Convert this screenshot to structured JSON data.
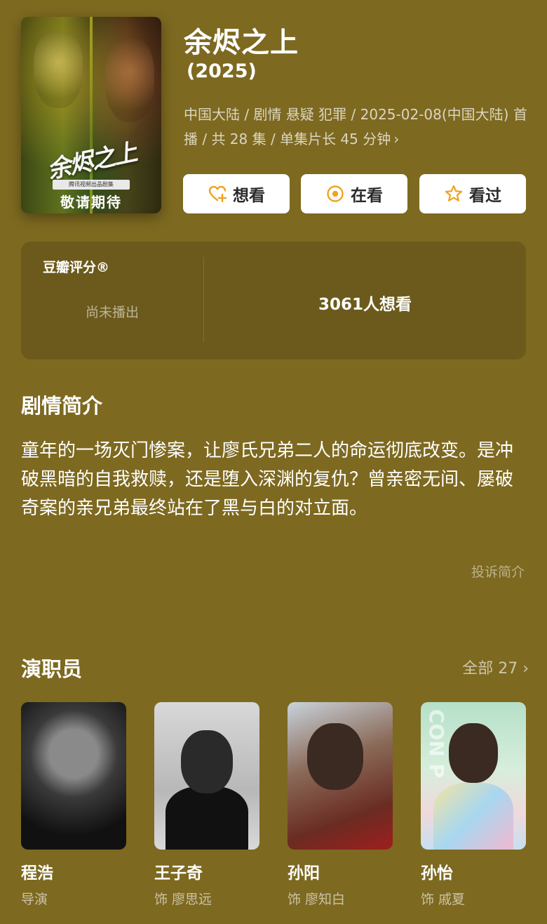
{
  "header": {
    "poster": {
      "logo_text": "余烬之上",
      "badge_text": "腾讯视频出品剧集",
      "coming_text": "敬请期待"
    },
    "title": "余烬之上",
    "year": "(2025)",
    "meta_line": "中国大陆 / 剧情 悬疑 犯罪 / 2025-02-08(中国大陆) 首播 / 共 28 集 / 单集片长 45 分钟",
    "meta_chevron": "›"
  },
  "actions": {
    "want_label": "想看",
    "watching_label": "在看",
    "watched_label": "看过"
  },
  "rating": {
    "label": "豆瓣评分®",
    "status": "尚未播出",
    "want_count_text": "3061人想看"
  },
  "synopsis": {
    "title": "剧情简介",
    "text": "童年的一场灭门惨案，让廖氏兄弟二人的命运彻底改变。是冲破黑暗的自我救赎，还是堕入深渊的复仇？曾亲密无间、屡破奇案的亲兄弟最终站在了黑与白的对立面。",
    "report_link": "投诉简介"
  },
  "cast": {
    "title": "演职员",
    "all_link": "全部 27 ›",
    "members": [
      {
        "name": "程浩",
        "role": "导演"
      },
      {
        "name": "王子奇",
        "role": "饰 廖思远"
      },
      {
        "name": "孙阳",
        "role": "饰 廖知白"
      },
      {
        "name": "孙怡",
        "role": "饰 戚夏"
      }
    ],
    "photo4_mark": "CON P"
  },
  "colors": {
    "page_bg": "#7d6920",
    "card_bg": "#6c5a1c",
    "button_bg": "#ffffff",
    "accent_orange": "#f0a31f"
  }
}
